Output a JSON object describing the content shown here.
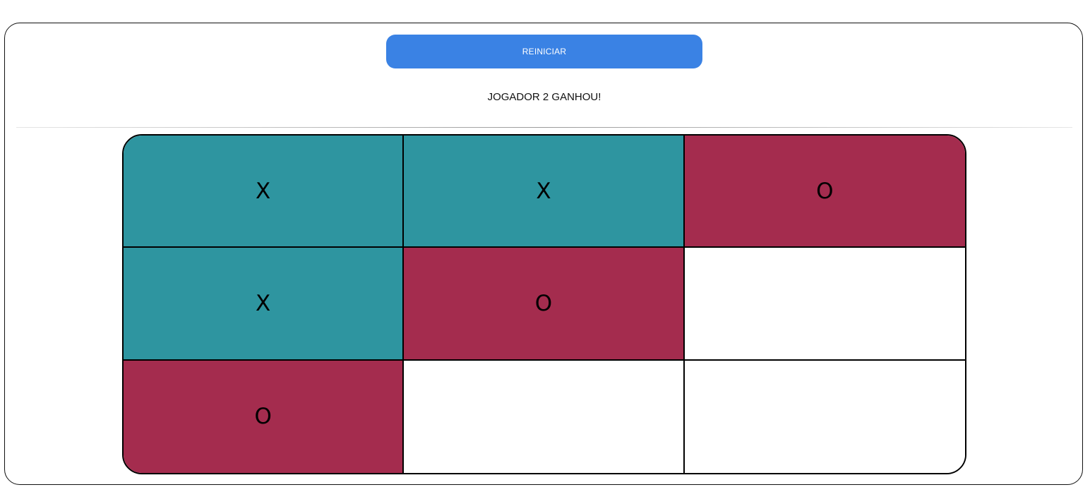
{
  "restart_button": {
    "label": "REINICIAR"
  },
  "status": {
    "text": "JOGADOR 2 GANHOU!"
  },
  "colors": {
    "button": "#3a82e4",
    "x_cell": "#2e95a0",
    "o_cell": "#a42c4e",
    "empty_cell": "#ffffff"
  },
  "board": {
    "cells": [
      {
        "mark": "X"
      },
      {
        "mark": "X"
      },
      {
        "mark": "O"
      },
      {
        "mark": "X"
      },
      {
        "mark": "O"
      },
      {
        "mark": ""
      },
      {
        "mark": "O"
      },
      {
        "mark": ""
      },
      {
        "mark": ""
      }
    ]
  }
}
